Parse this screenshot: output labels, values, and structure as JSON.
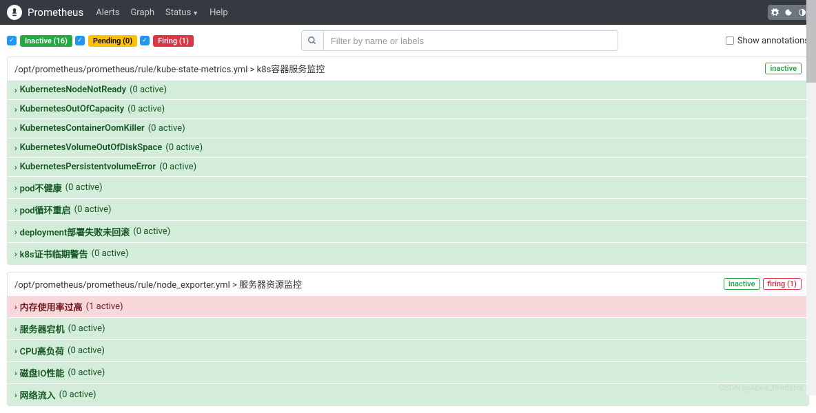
{
  "navbar": {
    "brand": "Prometheus",
    "links": [
      "Alerts",
      "Graph",
      "Status",
      "Help"
    ]
  },
  "filters": {
    "inactive": "Inactive (16)",
    "pending": "Pending (0)",
    "firing": "Firing (1)"
  },
  "search": {
    "placeholder": "Filter by name or labels"
  },
  "annotations_label": "Show annotations",
  "groups": [
    {
      "path": "/opt/prometheus/prometheus/rule/kube-state-metrics.yml > k8s容器服务监控",
      "badges": [
        {
          "text": "inactive",
          "cls": "badge-inactive-outline"
        }
      ],
      "alerts": [
        {
          "name": "KubernetesNodeNotReady",
          "count": "(0 active)",
          "state": "green"
        },
        {
          "name": "KubernetesOutOfCapacity",
          "count": "(0 active)",
          "state": "green"
        },
        {
          "name": "KubernetesContainerOomKiller",
          "count": "(0 active)",
          "state": "green"
        },
        {
          "name": "KubernetesVolumeOutOfDiskSpace",
          "count": "(0 active)",
          "state": "green"
        },
        {
          "name": "KubernetesPersistentvolumeError",
          "count": "(0 active)",
          "state": "green"
        },
        {
          "name": "pod不健康",
          "count": "(0 active)",
          "state": "green"
        },
        {
          "name": "pod循环重启",
          "count": "(0 active)",
          "state": "green"
        },
        {
          "name": "deployment部署失败未回滚",
          "count": "(0 active)",
          "state": "green"
        },
        {
          "name": "k8s证书临期警告",
          "count": "(0 active)",
          "state": "green"
        }
      ]
    },
    {
      "path": "/opt/prometheus/prometheus/rule/node_exporter.yml > 服务器资源监控",
      "badges": [
        {
          "text": "inactive",
          "cls": "badge-inactive-outline"
        },
        {
          "text": "firing (1)",
          "cls": "badge-firing-outline"
        }
      ],
      "alerts": [
        {
          "name": "内存使用率过高",
          "count": "(1 active)",
          "state": "red"
        },
        {
          "name": "服务器宕机",
          "count": "(0 active)",
          "state": "green"
        },
        {
          "name": "CPU高负荷",
          "count": "(0 active)",
          "state": "green"
        },
        {
          "name": "磁盘IO性能",
          "count": "(0 active)",
          "state": "green"
        },
        {
          "name": "网络流入",
          "count": "(0 active)",
          "state": "green"
        }
      ]
    }
  ],
  "watermark": "CSDN @Apex_Predator"
}
